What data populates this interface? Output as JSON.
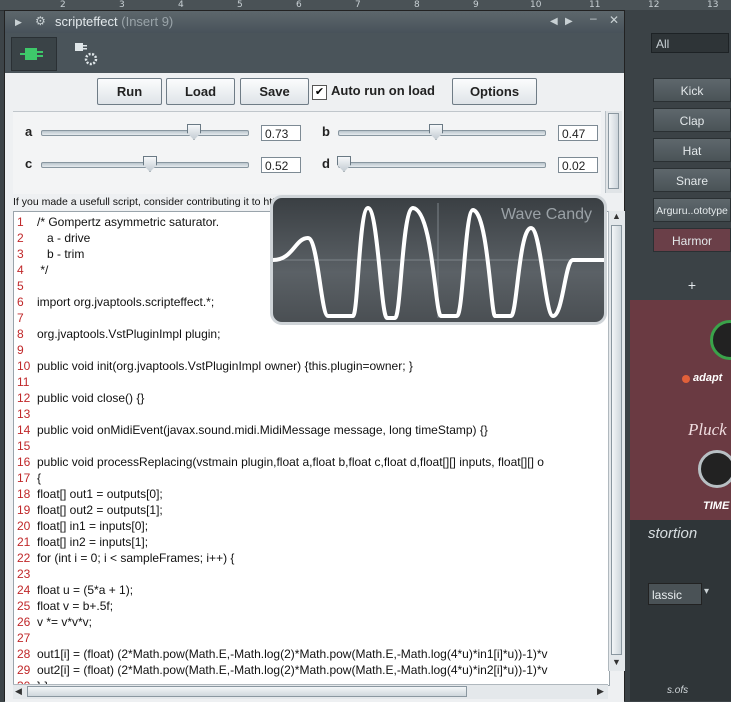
{
  "ruler": {
    "ticks": [
      "2",
      "3",
      "4",
      "5",
      "6",
      "7",
      "8",
      "9",
      "10",
      "11",
      "12",
      "13"
    ]
  },
  "window": {
    "title": "scripteffect",
    "title_suffix": "(Insert 9)",
    "icons": [
      "plug-icon",
      "gear-plug-icon"
    ]
  },
  "toolbar": {
    "run_label": "Run",
    "load_label": "Load",
    "save_label": "Save",
    "autorun_label": "Auto run on load",
    "autorun_checked": true,
    "options_label": "Options"
  },
  "params": [
    {
      "name": "a",
      "value": "0.73"
    },
    {
      "name": "b",
      "value": "0.47"
    },
    {
      "name": "c",
      "value": "0.52"
    },
    {
      "name": "d",
      "value": "0.02"
    }
  ],
  "info_text": "If you made a usefull script, consider contributing it to http://jvaptools.sourceforge.net/scripteffect/scripts.html",
  "code_lines": [
    "/* Gompertz asymmetric saturator.",
    "   a - drive",
    "   b - trim",
    " */",
    "",
    "import org.jvaptools.scripteffect.*;",
    "",
    "org.jvaptools.VstPluginImpl plugin;",
    "",
    "public void init(org.jvaptools.VstPluginImpl owner) {this.plugin=owner; }",
    "",
    "public void close() {}",
    "",
    "public void onMidiEvent(javax.sound.midi.MidiMessage message, long timeStamp) {}",
    "",
    "public void processReplacing(vstmain plugin,float a,float b,float c,float d,float[][] inputs, float[][] o",
    "{",
    "float[] out1 = outputs[0];",
    "float[] out2 = outputs[1];",
    "float[] in1 = inputs[0];",
    "float[] in2 = inputs[1];",
    "for (int i = 0; i < sampleFrames; i++) {",
    "",
    "float u = (5*a + 1);",
    "float v = b+.5f;",
    "v *= v*v*v;",
    "",
    "out1[i] = (float) (2*Math.pow(Math.E,-Math.log(2)*Math.pow(Math.E,-Math.log(4*u)*in1[i]*u))-1)*v",
    "out2[i] = (float) (2*Math.pow(Math.E,-Math.log(2)*Math.pow(Math.E,-Math.log(4*u)*in2[i]*u))-1)*v",
    "} }"
  ],
  "overlay": {
    "logo_text": "Wave Candy"
  },
  "right_panel": {
    "filter_label": "All",
    "channels": [
      "Kick",
      "Clap",
      "Hat",
      "Snare",
      "Arguru..ototype",
      "Harmor"
    ],
    "plus_label": "+",
    "adapt_label": "adapt",
    "pluck_label": "Pluck",
    "time_label": "TIME",
    "distortion_label": "stortion",
    "classic_label": "lassic",
    "sofs_label": "s.ofs"
  },
  "colors": {
    "line_numbers": "#c0282a",
    "title_bar": "#48525a",
    "accent_icon": "#3ec96a"
  }
}
